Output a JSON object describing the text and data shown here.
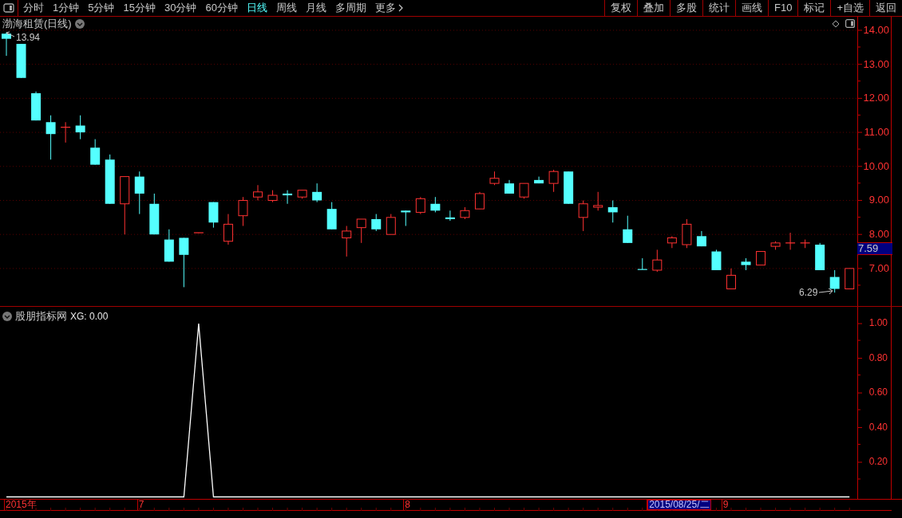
{
  "toolbar": {
    "periods": [
      {
        "label": "分时",
        "selected": false
      },
      {
        "label": "1分钟",
        "selected": false
      },
      {
        "label": "5分钟",
        "selected": false
      },
      {
        "label": "15分钟",
        "selected": false
      },
      {
        "label": "30分钟",
        "selected": false
      },
      {
        "label": "60分钟",
        "selected": false
      },
      {
        "label": "日线",
        "selected": true
      },
      {
        "label": "周线",
        "selected": false
      },
      {
        "label": "月线",
        "selected": false
      },
      {
        "label": "多周期",
        "selected": false
      },
      {
        "label": "更多",
        "selected": false
      }
    ],
    "buttons": [
      "复权",
      "叠加",
      "多股",
      "统计",
      "画线",
      "F10",
      "标记",
      "+自选",
      "返回"
    ]
  },
  "price_panel": {
    "title": "渤海租赁(日线)",
    "high_label": "13.94",
    "low_label": "6.29",
    "current_price": "7.59",
    "chart_data": {
      "type": "candlestick",
      "ylim": [
        5.873,
        14.398
      ],
      "yticks": [
        {
          "value": 14,
          "label": "14.00"
        },
        {
          "value": 13,
          "label": "13.00"
        },
        {
          "value": 12,
          "label": "12.00"
        },
        {
          "value": 11,
          "label": "11.00"
        },
        {
          "value": 10,
          "label": "10.00"
        },
        {
          "value": 9,
          "label": "9.00"
        },
        {
          "value": 8,
          "label": "8.00"
        },
        {
          "value": 7,
          "label": "7.00"
        }
      ],
      "ohlc": [
        [
          13.9,
          13.94,
          13.25,
          13.75
        ],
        [
          13.6,
          13.6,
          12.6,
          12.6
        ],
        [
          12.15,
          12.2,
          11.35,
          11.35
        ],
        [
          11.3,
          11.5,
          10.2,
          10.95
        ],
        [
          11.15,
          11.3,
          10.7,
          11.15
        ],
        [
          11.2,
          11.5,
          10.8,
          11.0
        ],
        [
          10.55,
          10.8,
          10.05,
          10.05
        ],
        [
          10.2,
          10.35,
          8.9,
          8.9
        ],
        [
          8.9,
          9.7,
          8.0,
          9.7
        ],
        [
          9.7,
          9.85,
          8.6,
          9.2
        ],
        [
          8.9,
          9.2,
          8.0,
          8.0
        ],
        [
          7.85,
          8.15,
          7.2,
          7.2
        ],
        [
          7.9,
          7.9,
          6.45,
          7.4
        ],
        [
          8.05,
          8.05,
          8.05,
          8.05
        ],
        [
          8.95,
          8.95,
          8.2,
          8.35
        ],
        [
          7.8,
          8.6,
          7.7,
          8.3
        ],
        [
          8.55,
          9.1,
          8.25,
          9.0
        ],
        [
          9.1,
          9.45,
          9.0,
          9.25
        ],
        [
          9.0,
          9.3,
          8.95,
          9.15
        ],
        [
          9.2,
          9.3,
          8.9,
          9.15
        ],
        [
          9.1,
          9.3,
          9.05,
          9.3
        ],
        [
          9.25,
          9.5,
          8.95,
          9.0
        ],
        [
          8.75,
          8.95,
          8.15,
          8.15
        ],
        [
          7.9,
          8.25,
          7.35,
          8.1
        ],
        [
          8.2,
          8.45,
          7.75,
          8.45
        ],
        [
          8.45,
          8.6,
          8.1,
          8.15
        ],
        [
          8.0,
          8.6,
          8.0,
          8.5
        ],
        [
          8.7,
          8.7,
          8.25,
          8.65
        ],
        [
          8.65,
          9.1,
          8.6,
          9.05
        ],
        [
          8.9,
          9.1,
          8.65,
          8.7
        ],
        [
          8.5,
          8.7,
          8.4,
          8.45
        ],
        [
          8.5,
          8.8,
          8.45,
          8.7
        ],
        [
          8.75,
          9.25,
          8.75,
          9.2
        ],
        [
          9.5,
          9.85,
          9.45,
          9.65
        ],
        [
          9.5,
          9.6,
          9.2,
          9.2
        ],
        [
          9.1,
          9.5,
          9.05,
          9.5
        ],
        [
          9.6,
          9.7,
          9.5,
          9.5
        ],
        [
          9.5,
          9.9,
          9.25,
          9.85
        ],
        [
          9.85,
          9.85,
          8.9,
          8.9
        ],
        [
          8.5,
          9.0,
          8.1,
          8.9
        ],
        [
          8.8,
          9.25,
          8.7,
          8.85
        ],
        [
          8.8,
          9.0,
          8.35,
          8.65
        ],
        [
          8.15,
          8.55,
          7.75,
          7.75
        ],
        [
          6.97,
          7.3,
          6.97,
          6.97
        ],
        [
          6.95,
          7.55,
          6.9,
          7.25
        ],
        [
          7.75,
          7.95,
          7.6,
          7.9
        ],
        [
          7.7,
          8.45,
          7.6,
          8.3
        ],
        [
          7.95,
          8.1,
          7.65,
          7.65
        ],
        [
          7.5,
          7.55,
          6.95,
          6.95
        ],
        [
          6.4,
          7.0,
          6.4,
          6.8
        ],
        [
          7.2,
          7.3,
          6.95,
          7.1
        ],
        [
          7.1,
          7.5,
          7.1,
          7.5
        ],
        [
          7.65,
          7.8,
          7.55,
          7.75
        ],
        [
          7.75,
          8.05,
          7.55,
          7.75
        ],
        [
          7.75,
          7.85,
          7.6,
          7.75
        ],
        [
          7.7,
          7.75,
          6.95,
          6.95
        ],
        [
          6.75,
          6.95,
          6.29,
          6.4
        ],
        [
          6.4,
          7.0,
          6.4,
          7.0
        ]
      ],
      "grid": true
    }
  },
  "indicator_panel": {
    "title": "股朋指标网",
    "reading": ": 0.00",
    "chart_data": {
      "type": "line",
      "ylim": [
        -0.016,
        1.097
      ],
      "yticks": [
        {
          "value": 1,
          "label": "1.00"
        },
        {
          "value": 0.8,
          "label": "0.80"
        },
        {
          "value": 0.6,
          "label": "0.60"
        },
        {
          "value": 0.4,
          "label": "0.40"
        },
        {
          "value": 0.2,
          "label": "0.20"
        }
      ],
      "series": [
        {
          "name": "XG",
          "color": "#ffffff",
          "values": [
            0,
            0,
            0,
            0,
            0,
            0,
            0,
            0,
            0,
            0,
            0,
            0,
            0,
            1,
            0,
            0,
            0,
            0,
            0,
            0,
            0,
            0,
            0,
            0,
            0,
            0,
            0,
            0,
            0,
            0,
            0,
            0,
            0,
            0,
            0,
            0,
            0,
            0,
            0,
            0,
            0,
            0,
            0,
            0,
            0,
            0,
            0,
            0,
            0,
            0,
            0,
            0,
            0,
            0,
            0,
            0,
            0,
            0
          ]
        }
      ]
    }
  },
  "date_axis": [
    {
      "label": "2015年",
      "selected": false
    },
    {
      "label": "7",
      "selected": false
    },
    {
      "label": "8",
      "selected": false
    },
    {
      "label": "2015/08/25/二",
      "selected": true
    },
    {
      "label": "9",
      "selected": false
    }
  ]
}
